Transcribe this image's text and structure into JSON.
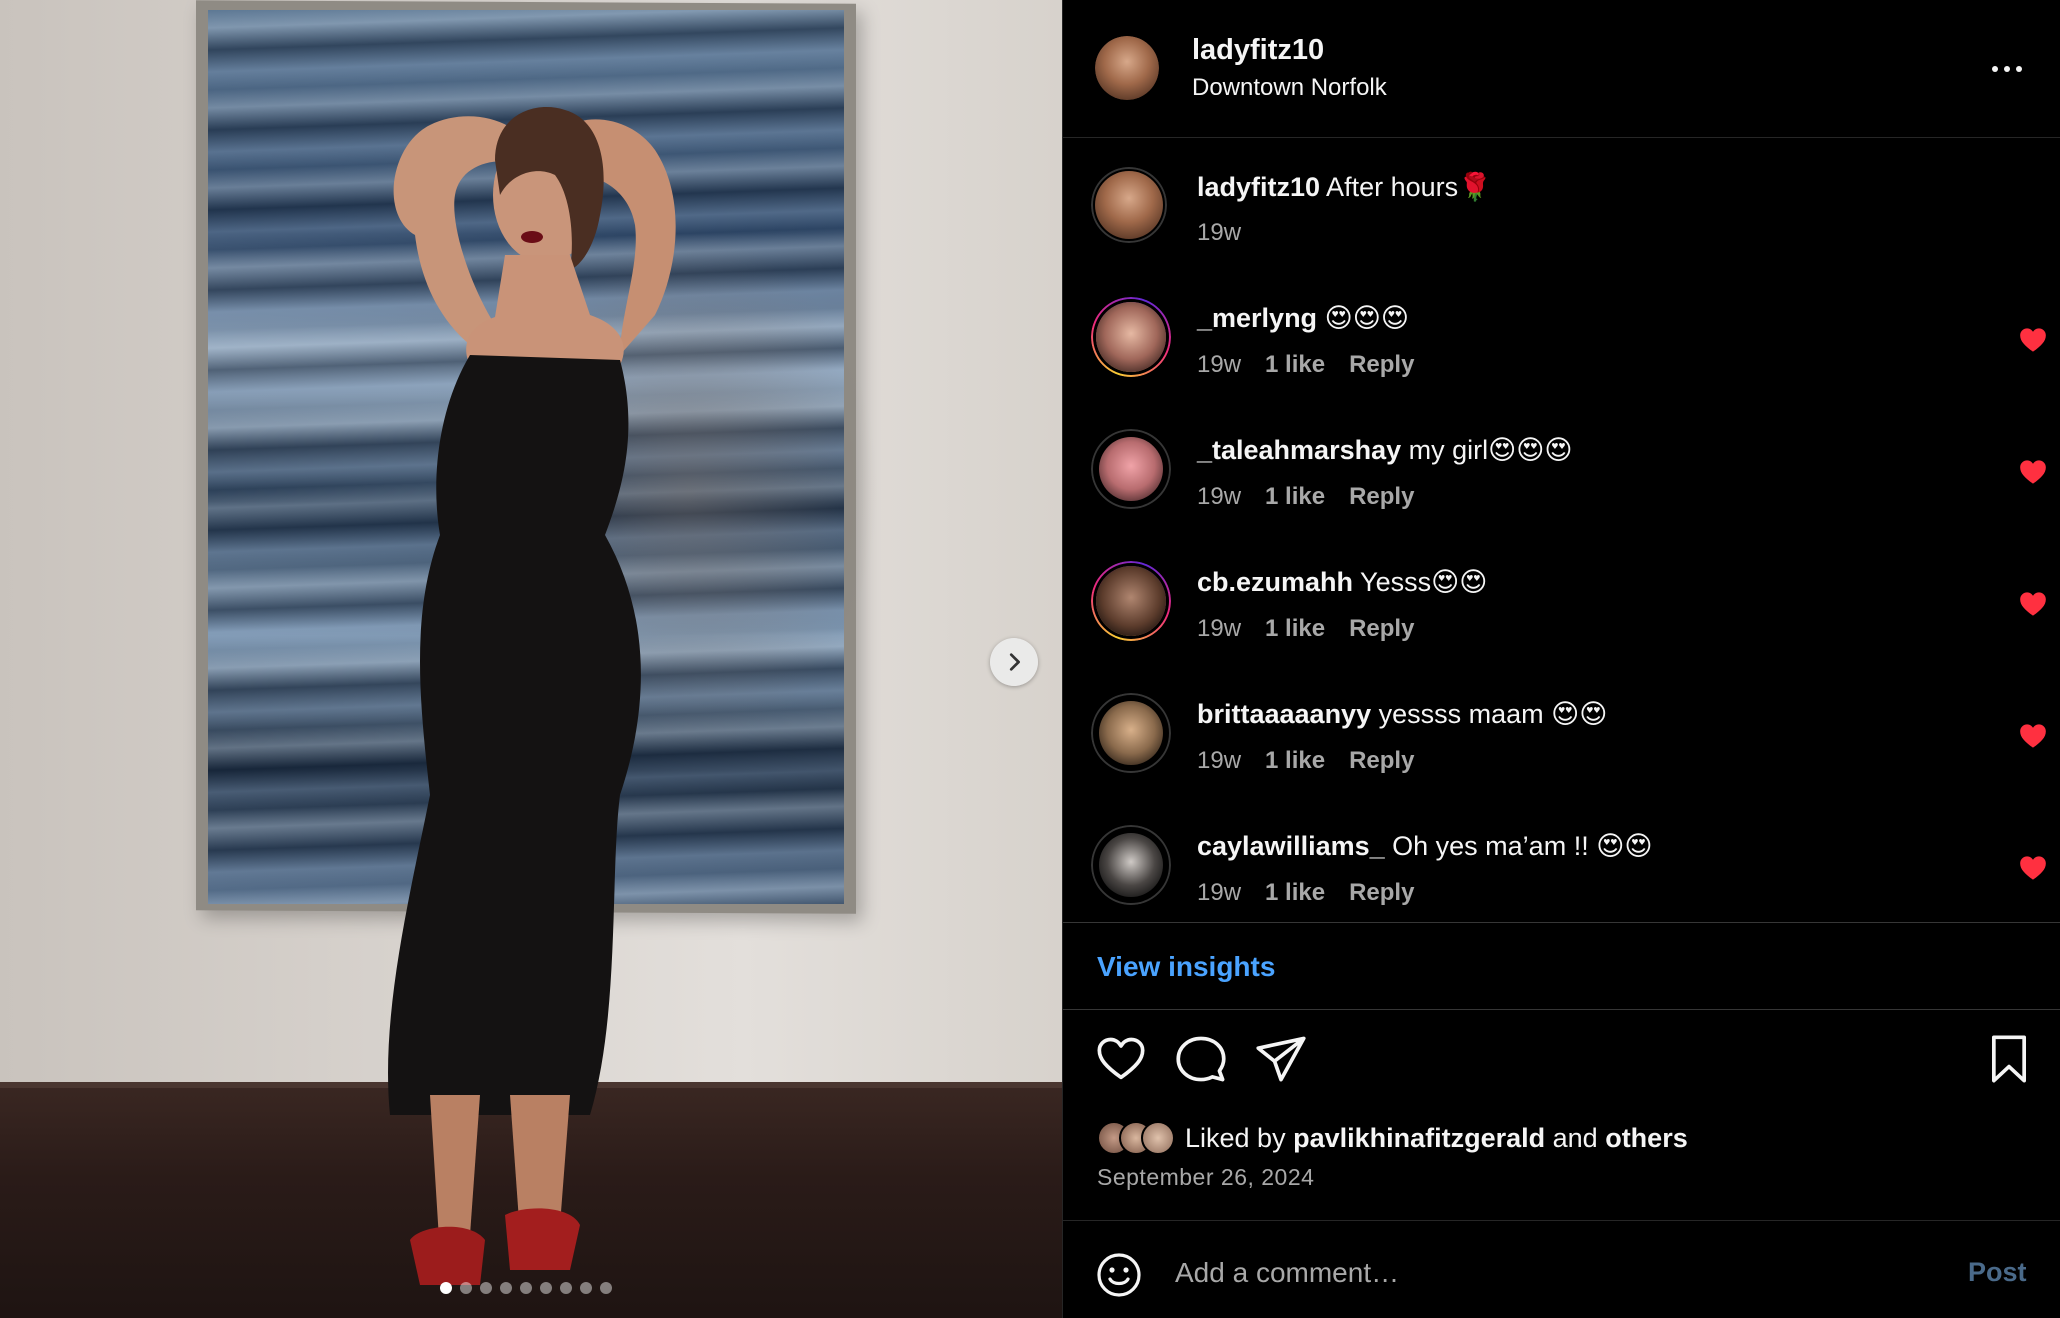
{
  "post": {
    "username": "ladyfitz10",
    "location": "Downtown Norfolk",
    "caption_username": "ladyfitz10",
    "caption_text": " After hours🌹",
    "caption_time": "19w",
    "carousel": {
      "count": 9,
      "active_index": 0
    }
  },
  "comments": [
    {
      "username": "_merlyng",
      "text": " 😍😍😍",
      "time": "19w",
      "likes": "1 like",
      "reply": "Reply",
      "story_ring": true
    },
    {
      "username": "_taleahmarshay",
      "text": " my girl😍😍😍",
      "time": "19w",
      "likes": "1 like",
      "reply": "Reply",
      "story_ring": false
    },
    {
      "username": "cb.ezumahh",
      "text": " Yesss😍😍",
      "time": "19w",
      "likes": "1 like",
      "reply": "Reply",
      "story_ring": true
    },
    {
      "username": "brittaaaaanyy",
      "text": " yessss maam 😍😍",
      "time": "19w",
      "likes": "1 like",
      "reply": "Reply",
      "story_ring": false
    },
    {
      "username": "caylawilliams_",
      "text": " Oh yes ma’am !! 😍😍",
      "time": "19w",
      "likes": "1 like",
      "reply": "Reply",
      "story_ring": false
    }
  ],
  "insights": {
    "label": "View insights"
  },
  "likes": {
    "prefix": "Liked by ",
    "user": "pavlikhinafitzgerald",
    "middle": " and ",
    "others": "others"
  },
  "date": "September 26, 2024",
  "comment_box": {
    "placeholder": "Add a comment…",
    "post_label": "Post"
  },
  "icons": {
    "more": "more-horizontal-icon",
    "next": "chevron-right-icon",
    "like": "heart-outline-icon",
    "comment": "comment-bubble-icon",
    "share": "paper-plane-icon",
    "save": "bookmark-icon",
    "emoji": "smiley-icon",
    "comment_like": "heart-filled-icon"
  },
  "colors": {
    "background": "#000000",
    "link_blue": "#4aa3ff",
    "heart_red": "#ff3040",
    "muted_text": "#a8a8a8"
  }
}
